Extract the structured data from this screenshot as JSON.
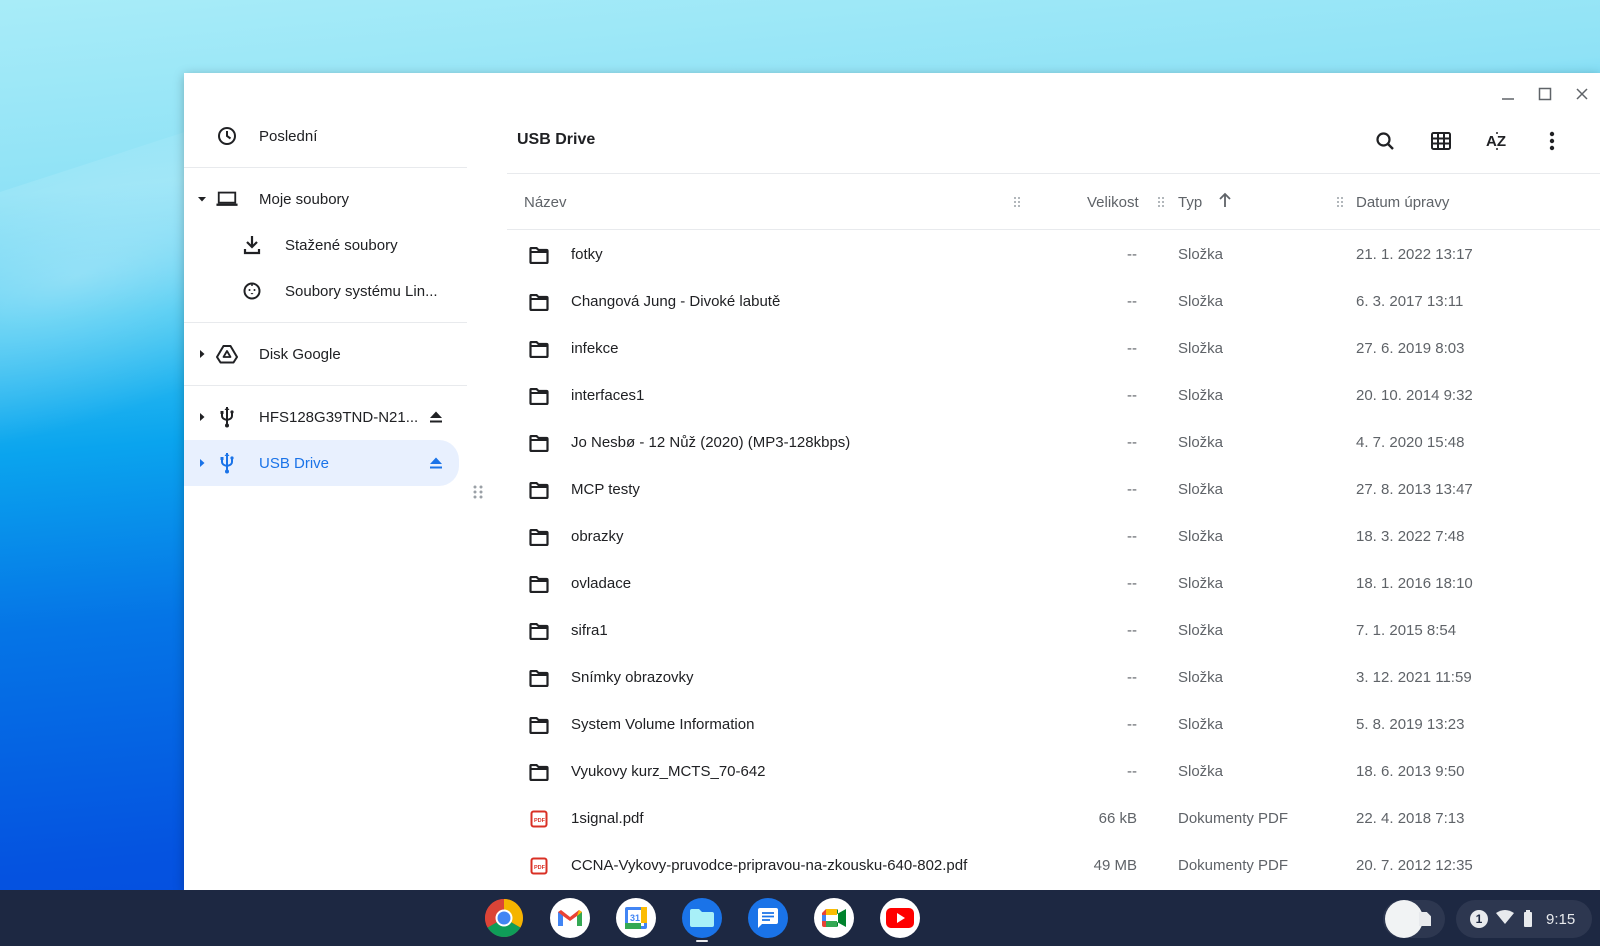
{
  "window": {
    "controls": {
      "minimize": "minimize",
      "maximize": "maximize",
      "close": "close"
    }
  },
  "sidebar": {
    "items": [
      {
        "label": "Poslední",
        "icon": "clock-icon"
      },
      {
        "label": "Moje soubory",
        "icon": "laptop-icon",
        "expanded": true
      },
      {
        "label": "Stažené soubory",
        "icon": "download-icon"
      },
      {
        "label": "Soubory systému Lin...",
        "icon": "linux-penguin-icon"
      },
      {
        "label": "Disk Google",
        "icon": "google-drive-icon",
        "expanded": false
      },
      {
        "label": "HFS128G39TND-N21...",
        "icon": "usb-icon",
        "eject": true
      },
      {
        "label": "USB Drive",
        "icon": "usb-icon",
        "eject": true,
        "active": true
      }
    ],
    "accent_color": "#1a73e8",
    "active_bg": "#e8f0fe"
  },
  "toolbar": {
    "breadcrumb": "USB Drive",
    "buttons": [
      "search-icon",
      "grid-view-icon",
      "sort-az-icon",
      "more-vertical-icon"
    ]
  },
  "list": {
    "columns": {
      "name": "Název",
      "size": "Velikost",
      "type": "Typ",
      "date": "Datum úpravy"
    },
    "sort": {
      "column": "Typ",
      "direction": "ascending"
    },
    "rows": [
      {
        "name": "fotky",
        "size": "--",
        "type": "Složka",
        "date": "21. 1. 2022 13:17",
        "kind": "folder"
      },
      {
        "name": "Changová Jung - Divoké labutě",
        "size": "--",
        "type": "Složka",
        "date": "6. 3. 2017 13:11",
        "kind": "folder"
      },
      {
        "name": "infekce",
        "size": "--",
        "type": "Složka",
        "date": "27. 6. 2019 8:03",
        "kind": "folder"
      },
      {
        "name": "interfaces1",
        "size": "--",
        "type": "Složka",
        "date": "20. 10. 2014 9:32",
        "kind": "folder"
      },
      {
        "name": "Jo Nesbø - 12 Nůž (2020) (MP3-128kbps)",
        "size": "--",
        "type": "Složka",
        "date": "4. 7. 2020 15:48",
        "kind": "folder"
      },
      {
        "name": "MCP testy",
        "size": "--",
        "type": "Složka",
        "date": "27. 8. 2013 13:47",
        "kind": "folder"
      },
      {
        "name": "obrazky",
        "size": "--",
        "type": "Složka",
        "date": "18. 3. 2022 7:48",
        "kind": "folder"
      },
      {
        "name": "ovladace",
        "size": "--",
        "type": "Složka",
        "date": "18. 1. 2016 18:10",
        "kind": "folder"
      },
      {
        "name": "sifra1",
        "size": "--",
        "type": "Složka",
        "date": "7. 1. 2015 8:54",
        "kind": "folder"
      },
      {
        "name": "Snímky obrazovky",
        "size": "--",
        "type": "Složka",
        "date": "3. 12. 2021 11:59",
        "kind": "folder"
      },
      {
        "name": "System Volume Information",
        "size": "--",
        "type": "Složka",
        "date": "5. 8. 2019 13:23",
        "kind": "folder"
      },
      {
        "name": "Vyukovy kurz_MCTS_70-642",
        "size": "--",
        "type": "Složka",
        "date": "18. 6. 2013 9:50",
        "kind": "folder"
      },
      {
        "name": "1signal.pdf",
        "size": "66 kB",
        "type": "Dokumenty PDF",
        "date": "22. 4. 2018 7:13",
        "kind": "pdf"
      },
      {
        "name": "CCNA-Vykovy-pruvodce-pripravou-na-zkousku-640-802.pdf",
        "size": "49 MB",
        "type": "Dokumenty PDF",
        "date": "20. 7. 2012 12:35",
        "kind": "pdf"
      }
    ]
  },
  "shelf": {
    "apps": [
      {
        "name": "Chrome",
        "icon": "chrome-icon"
      },
      {
        "name": "Gmail",
        "icon": "gmail-icon"
      },
      {
        "name": "Calendar",
        "icon": "calendar-icon",
        "badge": "31"
      },
      {
        "name": "Files",
        "icon": "files-icon",
        "open": true
      },
      {
        "name": "Messages",
        "icon": "messages-icon"
      },
      {
        "name": "Meet",
        "icon": "meet-icon"
      },
      {
        "name": "YouTube",
        "icon": "youtube-icon"
      }
    ],
    "status": {
      "notification_count": "1",
      "time": "9:15"
    }
  }
}
